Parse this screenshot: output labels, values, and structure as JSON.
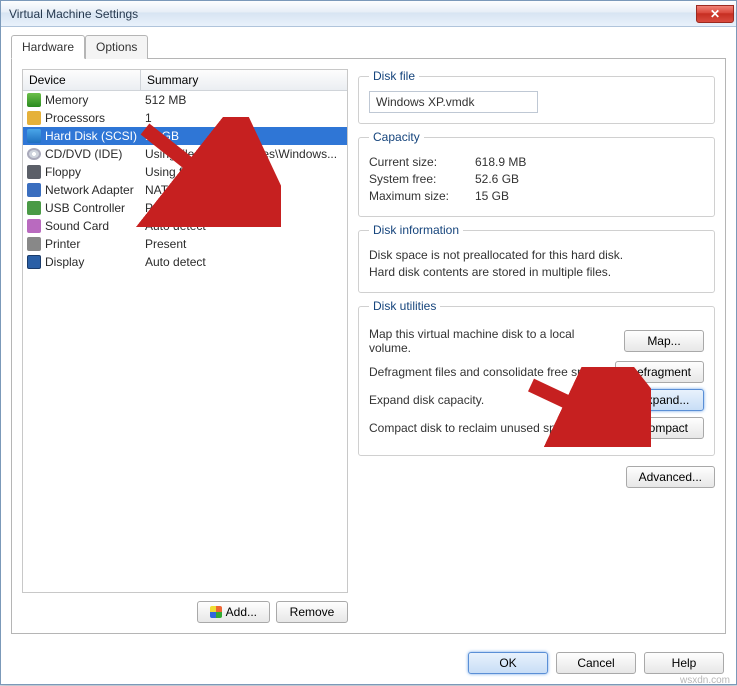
{
  "window": {
    "title": "Virtual Machine Settings"
  },
  "tabs": {
    "hardware": "Hardware",
    "options": "Options"
  },
  "columns": {
    "device": "Device",
    "summary": "Summary"
  },
  "devices": [
    {
      "icon": "ico-mem",
      "name": "Memory",
      "summary": "512 MB"
    },
    {
      "icon": "ico-cpu",
      "name": "Processors",
      "summary": "1"
    },
    {
      "icon": "ico-hd",
      "name": "Hard Disk (SCSI)",
      "summary": "15 GB",
      "selected": true
    },
    {
      "icon": "ico-cd",
      "name": "CD/DVD (IDE)",
      "summary": "Using file F:\\OS_Images\\Windows..."
    },
    {
      "icon": "ico-fl",
      "name": "Floppy",
      "summary": "Using file autoinst.flp"
    },
    {
      "icon": "ico-net",
      "name": "Network Adapter",
      "summary": "NAT"
    },
    {
      "icon": "ico-usb",
      "name": "USB Controller",
      "summary": "Present"
    },
    {
      "icon": "ico-snd",
      "name": "Sound Card",
      "summary": "Auto detect"
    },
    {
      "icon": "ico-prn",
      "name": "Printer",
      "summary": "Present"
    },
    {
      "icon": "ico-disp",
      "name": "Display",
      "summary": "Auto detect"
    }
  ],
  "left_buttons": {
    "add": "Add...",
    "remove": "Remove"
  },
  "diskfile": {
    "legend": "Disk file",
    "value": "Windows XP.vmdk"
  },
  "capacity": {
    "legend": "Capacity",
    "currentLabel": "Current size:",
    "currentVal": "618.9 MB",
    "freeLabel": "System free:",
    "freeVal": "52.6 GB",
    "maxLabel": "Maximum size:",
    "maxVal": "15 GB"
  },
  "diskinfo": {
    "legend": "Disk information",
    "line1": "Disk space is not preallocated for this hard disk.",
    "line2": "Hard disk contents are stored in multiple files."
  },
  "utilities": {
    "legend": "Disk utilities",
    "map": {
      "desc": "Map this virtual machine disk to a local volume.",
      "btn": "Map..."
    },
    "defragment": {
      "desc": "Defragment files and consolidate free space.",
      "btn": "Defragment"
    },
    "expand": {
      "desc": "Expand disk capacity.",
      "btn": "Expand..."
    },
    "compact": {
      "desc": "Compact disk to reclaim unused space.",
      "btn": "Compact"
    }
  },
  "advanced": "Advanced...",
  "footer": {
    "ok": "OK",
    "cancel": "Cancel",
    "help": "Help"
  },
  "watermark": "wsxdn.com"
}
